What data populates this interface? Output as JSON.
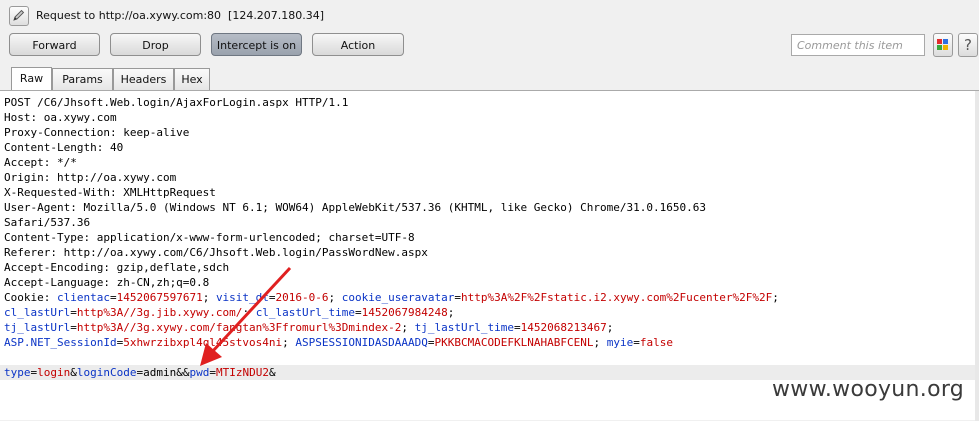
{
  "header": {
    "title": "Request to http://oa.xywy.com:80  [124.207.180.34]"
  },
  "toolbar": {
    "forward": "Forward",
    "drop": "Drop",
    "intercept": "Intercept is on",
    "action": "Action",
    "comment_placeholder": "Comment this item",
    "help": "?"
  },
  "tabs": [
    "Raw",
    "Params",
    "Headers",
    "Hex"
  ],
  "request_lines": [
    "POST /C6/Jhsoft.Web.login/AjaxForLogin.aspx HTTP/1.1",
    "Host: oa.xywy.com",
    "Proxy-Connection: keep-alive",
    "Content-Length: 40",
    "Accept: */*",
    "Origin: http://oa.xywy.com",
    "X-Requested-With: XMLHttpRequest",
    "User-Agent: Mozilla/5.0 (Windows NT 6.1; WOW64) AppleWebKit/537.36 (KHTML, like Gecko) Chrome/31.0.1650.63",
    "Safari/537.36",
    "Content-Type: application/x-www-form-urlencoded; charset=UTF-8",
    "Referer: http://oa.xywy.com/C6/Jhsoft.Web.login/PassWordNew.aspx",
    "Accept-Encoding: gzip,deflate,sdch",
    "Accept-Language: zh-CN,zh;q=0.8"
  ],
  "cookie": {
    "label": "Cookie: ",
    "line1": [
      {
        "t": "clientac",
        "c": "k"
      },
      {
        "t": "=",
        "c": ""
      },
      {
        "t": "1452067597671",
        "c": "v"
      },
      {
        "t": "; ",
        "c": ""
      },
      {
        "t": "visit_dt",
        "c": "k"
      },
      {
        "t": "=",
        "c": ""
      },
      {
        "t": "2016-0-6",
        "c": "v"
      },
      {
        "t": "; ",
        "c": ""
      },
      {
        "t": "cookie_useravatar",
        "c": "k"
      },
      {
        "t": "=",
        "c": ""
      },
      {
        "t": "http%3A%2F%2Fstatic.i2.xywy.com%2Fucenter%2F%2F",
        "c": "v"
      },
      {
        "t": ";",
        "c": ""
      }
    ],
    "line2": [
      {
        "t": "cl_lastUrl",
        "c": "k"
      },
      {
        "t": "=",
        "c": ""
      },
      {
        "t": "http%3A//3g.jib.xywy.com/",
        "c": "v"
      },
      {
        "t": "; ",
        "c": ""
      },
      {
        "t": "cl_lastUrl_time",
        "c": "k"
      },
      {
        "t": "=",
        "c": ""
      },
      {
        "t": "1452067984248",
        "c": "v"
      },
      {
        "t": ";",
        "c": ""
      }
    ],
    "line3": [
      {
        "t": "tj_lastUrl",
        "c": "k"
      },
      {
        "t": "=",
        "c": ""
      },
      {
        "t": "http%3A//3g.xywy.com/fangtan%3Ffromurl%3Dmindex-2",
        "c": "v"
      },
      {
        "t": "; ",
        "c": ""
      },
      {
        "t": "tj_lastUrl_time",
        "c": "k"
      },
      {
        "t": "=",
        "c": ""
      },
      {
        "t": "1452068213467",
        "c": "v"
      },
      {
        "t": ";",
        "c": ""
      }
    ],
    "line4": [
      {
        "t": "ASP.NET_SessionId",
        "c": "k"
      },
      {
        "t": "=",
        "c": ""
      },
      {
        "t": "5xhwrzibxpl4ql45stvos4ni",
        "c": "v"
      },
      {
        "t": "; ",
        "c": ""
      },
      {
        "t": "ASPSESSIONIDASDAAADQ",
        "c": "k"
      },
      {
        "t": "=",
        "c": ""
      },
      {
        "t": "PKKBCMACODEFKLNAHABFCENL",
        "c": "v"
      },
      {
        "t": "; ",
        "c": ""
      },
      {
        "t": "myie",
        "c": "k"
      },
      {
        "t": "=",
        "c": ""
      },
      {
        "t": "false",
        "c": "v"
      }
    ]
  },
  "body_params": [
    {
      "t": "type",
      "c": "k"
    },
    {
      "t": "=",
      "c": ""
    },
    {
      "t": "login",
      "c": "v"
    },
    {
      "t": "&",
      "c": ""
    },
    {
      "t": "loginCode",
      "c": "k"
    },
    {
      "t": "=",
      "c": ""
    },
    {
      "t": "admin",
      "c": ""
    },
    {
      "t": "&&",
      "c": ""
    },
    {
      "t": "pwd",
      "c": "k"
    },
    {
      "t": "=",
      "c": ""
    },
    {
      "t": "MTIzNDU2",
      "c": "v"
    },
    {
      "t": "&",
      "c": ""
    }
  ],
  "watermark": "www.wooyun.org",
  "colors": {
    "param_name": "#0b34c6",
    "param_value": "#c30000",
    "annotation_arrow": "#e02020"
  }
}
